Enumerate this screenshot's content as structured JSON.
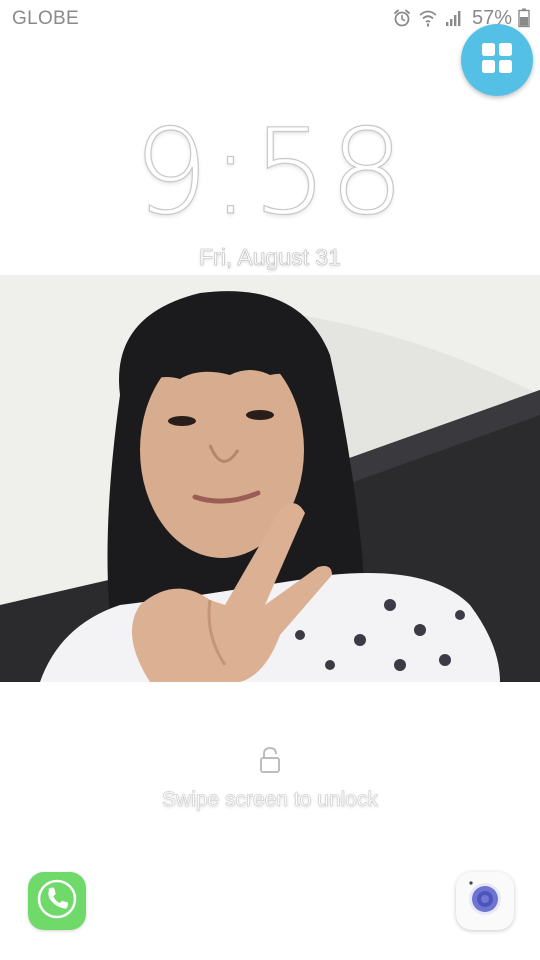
{
  "status_bar": {
    "carrier": "GLOBE",
    "battery_percent": "57%",
    "icons": [
      "alarm-icon",
      "wifi-icon",
      "signal-icon",
      "battery-icon"
    ]
  },
  "apps_button": {
    "icon": "apps-grid-icon",
    "color": "#55c0e6"
  },
  "lockscreen": {
    "time": "9:58",
    "date": "Fri, August 31",
    "unlock_hint": "Swipe screen to unlock"
  },
  "shortcuts": {
    "phone": {
      "icon": "phone-icon",
      "color": "#6fd96a"
    },
    "camera": {
      "icon": "camera-icon",
      "color": "#5a63c8"
    }
  }
}
